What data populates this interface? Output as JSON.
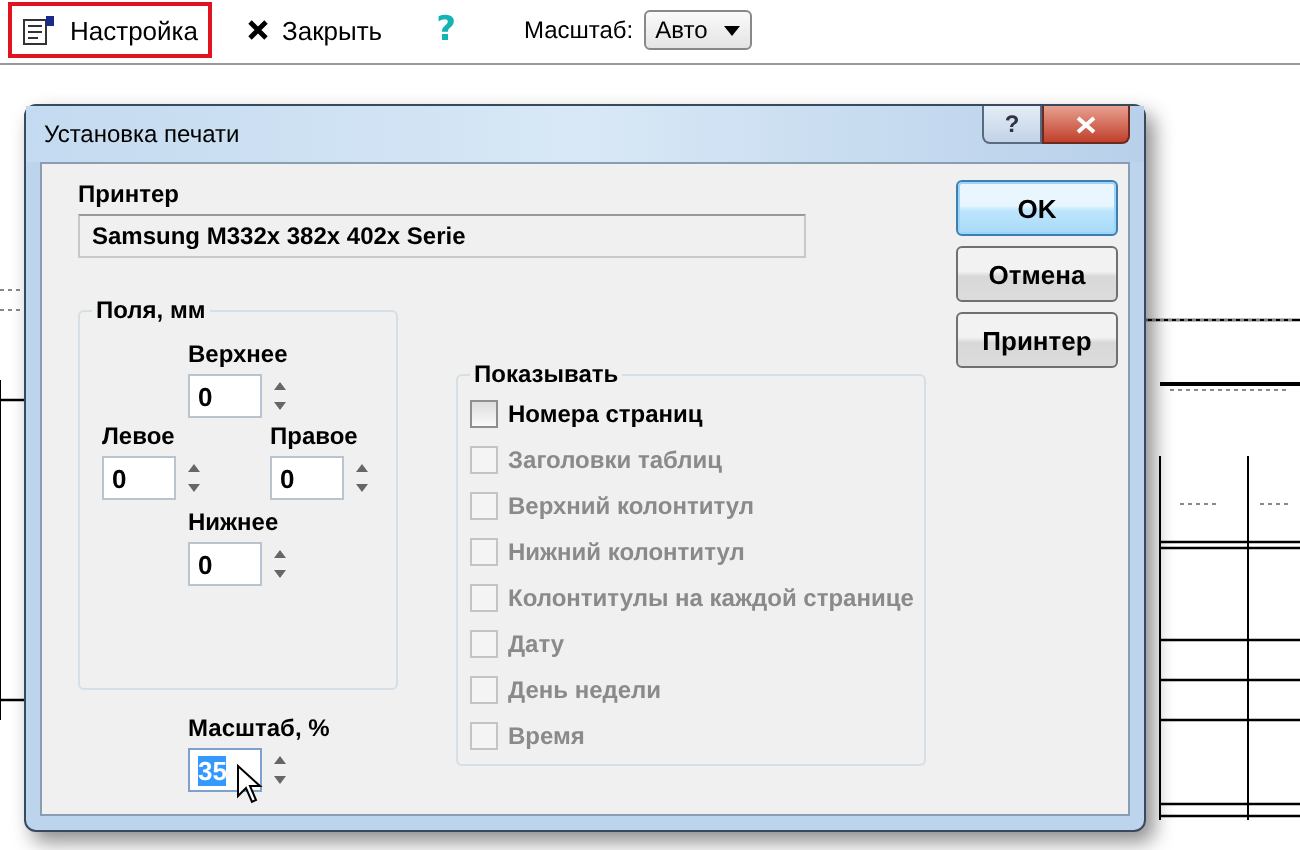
{
  "toolbar": {
    "items": [
      {
        "kind": "button",
        "label": "Настройка",
        "highlighted": true
      },
      {
        "kind": "button",
        "label": "Закрыть",
        "highlighted": false
      },
      {
        "kind": "help",
        "glyph": "?"
      }
    ],
    "zoom": {
      "label": "Масштаб:",
      "value": "Авто"
    }
  },
  "dialog": {
    "title": "Установка печати",
    "help_glyph": "?",
    "printer": {
      "label": "Принтер",
      "value": "Samsung M332x 382x 402x Serie"
    },
    "margins": {
      "title": "Поля, мм",
      "fields": [
        {
          "label": "Верхнее",
          "value": "0"
        },
        {
          "label": "Левое",
          "value": "0"
        },
        {
          "label": "Правое",
          "value": "0"
        },
        {
          "label": "Нижнее",
          "value": "0"
        }
      ]
    },
    "scale": {
      "label": "Масштаб, %",
      "value": "35",
      "selected": true
    },
    "show": {
      "title": "Показывать",
      "items": [
        {
          "label": "Номера страниц",
          "checked": false,
          "disabled": false
        },
        {
          "label": "Заголовки таблиц",
          "checked": false,
          "disabled": true
        },
        {
          "label": "Верхний колонтитул",
          "checked": false,
          "disabled": true
        },
        {
          "label": "Нижний колонтитул",
          "checked": false,
          "disabled": true
        },
        {
          "label": "Колонтитулы на каждой странице",
          "checked": false,
          "disabled": true
        },
        {
          "label": "Дату",
          "checked": false,
          "disabled": true
        },
        {
          "label": "День недели",
          "checked": false,
          "disabled": true
        },
        {
          "label": "Время",
          "checked": false,
          "disabled": true
        }
      ]
    },
    "buttons": [
      {
        "label": "OK",
        "default": true
      },
      {
        "label": "Отмена",
        "default": false
      },
      {
        "label": "Принтер",
        "default": false
      }
    ]
  }
}
